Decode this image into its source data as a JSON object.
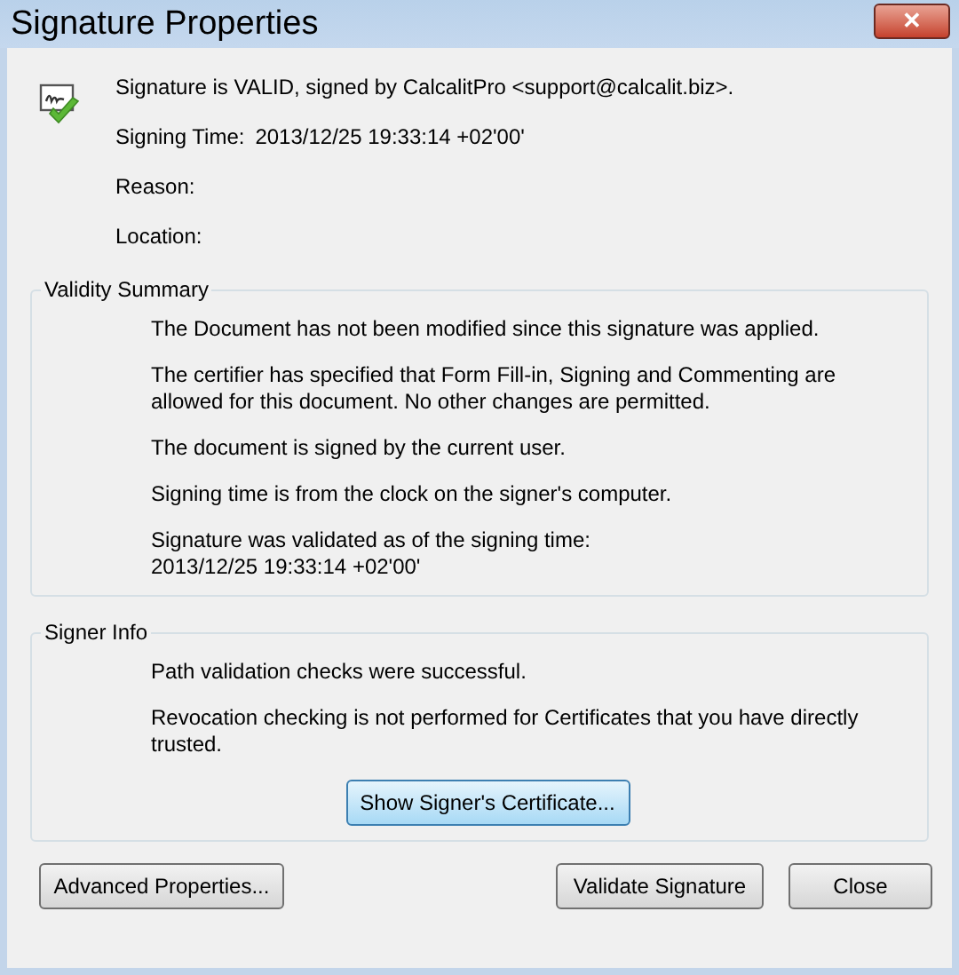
{
  "window": {
    "title": "Signature Properties",
    "close": "✕"
  },
  "header": {
    "status": "Signature is VALID, signed by CalcalitPro <support@calcalit.biz>.",
    "fields": [
      {
        "label": "Signing Time:",
        "value": "2013/12/25 19:33:14 +02'00'"
      },
      {
        "label": "Reason:"
      },
      {
        "label": "Location:"
      }
    ]
  },
  "validity_summary": {
    "title": "Validity Summary",
    "messages": [
      "The Document has not been modified since this signature was applied.",
      "The certifier has specified that Form Fill-in, Signing and Commenting are allowed for this document. No other changes are permitted.",
      "The document is signed by the current user.",
      "Signing time is from the clock on the signer's computer.",
      "Signature was validated as of the signing time:\n2013/12/25 19:33:14 +02'00'"
    ]
  },
  "signer_info": {
    "title": "Signer Info",
    "messages": [
      "Path validation checks were successful.",
      "Revocation checking is not performed for Certificates that you have directly trusted."
    ],
    "button": {
      "label": "Show Signer's Certificate...",
      "default": true
    }
  },
  "buttons": [
    {
      "label": "Advanced Properties...",
      "default": false
    },
    {
      "label": "Validate Signature",
      "default": false
    },
    {
      "label": "Close",
      "default": false
    }
  ]
}
